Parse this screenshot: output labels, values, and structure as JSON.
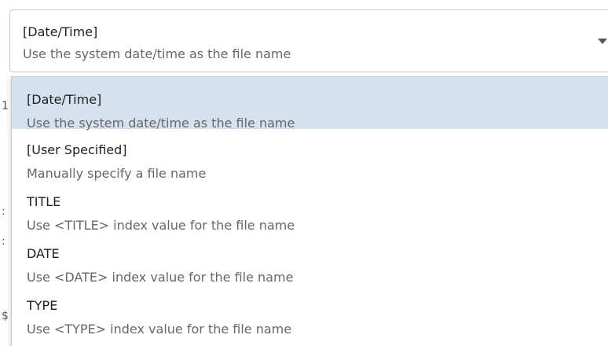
{
  "combo": {
    "selected_title": "[Date/Time]",
    "selected_description": "Use the system date/time as the file name",
    "arrow_icon": "caret-down-icon"
  },
  "dropdown": {
    "options": [
      {
        "title": "[Date/Time]",
        "description": "Use the system date/time as the file name",
        "selected": true
      },
      {
        "title": "[User Specified]",
        "description": "Manually specify a file name",
        "selected": false
      },
      {
        "title": "TITLE",
        "description": "Use <TITLE> index value for the file name",
        "selected": false
      },
      {
        "title": "DATE",
        "description": "Use <DATE> index value for the file name",
        "selected": false
      },
      {
        "title": "TYPE",
        "description": "Use <TYPE> index value for the file name",
        "selected": false
      }
    ]
  },
  "colors": {
    "selected_background": "#d6e1f0",
    "primary_text": "#1f1f1f",
    "secondary_text": "#666666",
    "border": "#c8c8c8"
  }
}
